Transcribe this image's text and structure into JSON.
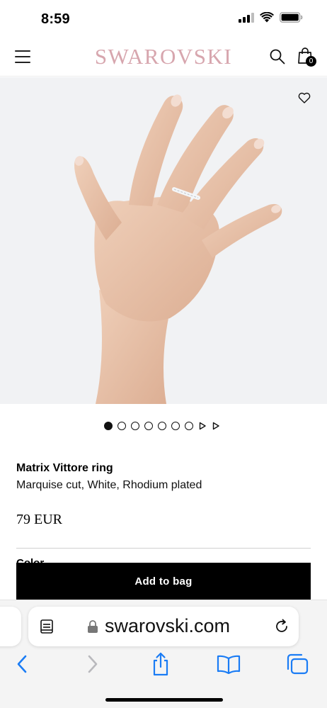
{
  "status_bar": {
    "time": "8:59"
  },
  "header": {
    "brand": "SWAROVSKI",
    "bag_count": "0"
  },
  "carousel": {
    "dot_count": 7,
    "active_index": 0
  },
  "product": {
    "title": "Matrix Vittore ring",
    "subtitle": "Marquise cut, White, Rhodium plated",
    "price": "79 EUR",
    "next_section_peek": "Color"
  },
  "actions": {
    "add_to_bag": "Add to bag"
  },
  "browser": {
    "url": "swarovski.com"
  },
  "colors": {
    "brand": "#d7a6ae",
    "button": "#000000",
    "browser_accent": "#1a7cf5"
  },
  "icons": [
    "menu-icon",
    "search-icon",
    "shopping-bag-icon",
    "heart-icon",
    "reader-icon",
    "lock-icon",
    "reload-icon",
    "back-icon",
    "forward-icon",
    "share-icon",
    "bookmarks-icon",
    "tabs-icon"
  ]
}
